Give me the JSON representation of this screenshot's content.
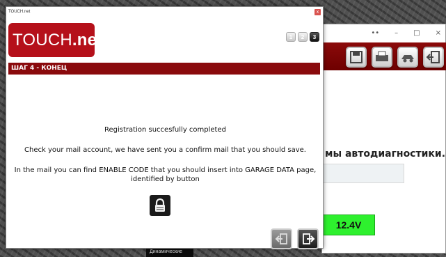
{
  "dialog": {
    "window_title": "TOUCH.net",
    "close_glyph": "x",
    "logo": {
      "part1": "TOUCH",
      "part2": ".net"
    },
    "steps": [
      "1",
      "2",
      "3"
    ],
    "active_step": 3,
    "banner": "ШАГ 4 - КОНЕЦ",
    "message_1": "Registration succesfully completed",
    "message_2": "Check your mail account, we have sent you a confirm mail that you should save.",
    "message_3a": "In the mail you can find ENABLE CODE that you should insert into GARAGE DATA page,",
    "message_3b": "identified by button",
    "icons": {
      "lock": "lock-icon",
      "back": "back-arrow-icon",
      "forward": "forward-exit-icon"
    }
  },
  "background_app": {
    "titlebar": {
      "drag": "••",
      "minimize": "–",
      "maximize": "□",
      "close": "×"
    },
    "heading": "мы автодиагностики...",
    "voltage": "12.4V",
    "bottom_panel_label": "Динамические"
  },
  "colors": {
    "brand_red": "#b5101a",
    "banner_red": "#8a0a0d",
    "voltage_green": "#2ef02e"
  }
}
